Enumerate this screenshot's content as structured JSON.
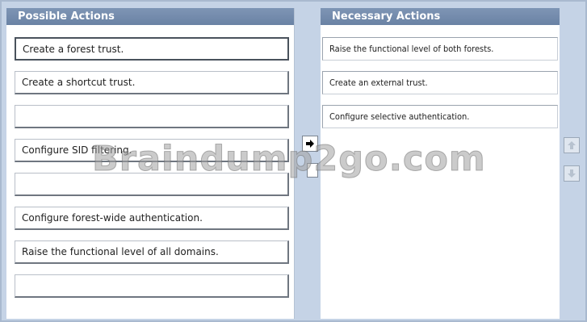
{
  "left_panel": {
    "title": "Possible Actions",
    "items": [
      {
        "label": "Create a forest trust."
      },
      {
        "label": "Create a shortcut trust."
      },
      {
        "label": ""
      },
      {
        "label": "Configure SID filtering."
      },
      {
        "label": ""
      },
      {
        "label": "Configure forest-wide authentication."
      },
      {
        "label": "Raise the functional level of all domains."
      },
      {
        "label": ""
      }
    ]
  },
  "right_panel": {
    "title": "Necessary Actions",
    "items": [
      {
        "label": "Raise the functional level of both forests."
      },
      {
        "label": "Create an external trust."
      },
      {
        "label": "Configure selective authentication."
      }
    ]
  },
  "controls": {
    "transfer_icon": "arrow-right-icon",
    "move_up_icon": "arrow-up-icon",
    "move_down_icon": "arrow-down-icon"
  },
  "watermark": "Braindump2go.com"
}
